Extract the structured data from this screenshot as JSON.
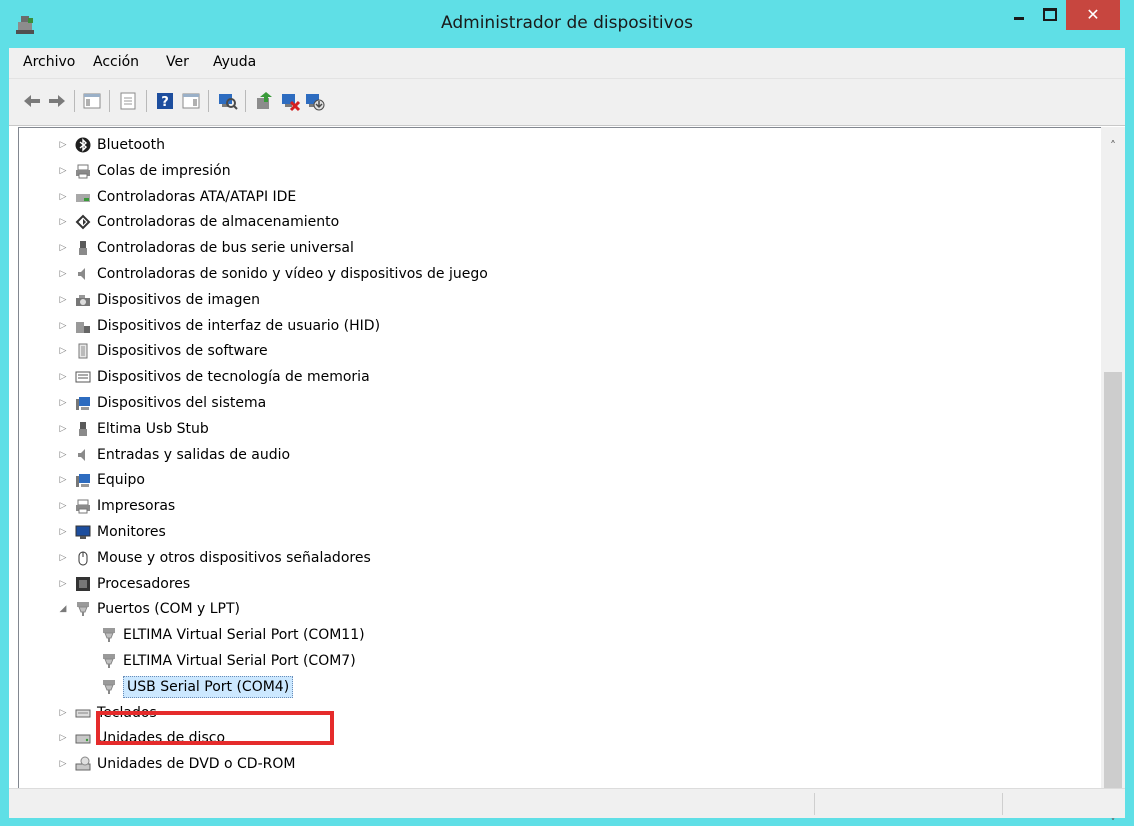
{
  "window": {
    "title": "Administrador de dispositivos",
    "close_glyph": "✕"
  },
  "menubar": {
    "items": [
      "Archivo",
      "Acción",
      "Ver",
      "Ayuda"
    ]
  },
  "toolbar": {
    "icons": [
      "back-arrow-icon",
      "forward-arrow-icon",
      "show-hide-console-tree-icon",
      "properties-icon",
      "help-icon",
      "show-action-pane-icon",
      "scan-hardware-changes-icon",
      "update-driver-icon",
      "uninstall-device-icon",
      "disable-device-icon"
    ]
  },
  "tree": {
    "items": [
      {
        "label": "Bluetooth",
        "icon": "bluetooth-icon",
        "expander": "▷",
        "level": 0
      },
      {
        "label": "Colas de impresión",
        "icon": "print-queue-icon",
        "expander": "▷",
        "level": 0
      },
      {
        "label": "Controladoras ATA/ATAPI IDE",
        "icon": "ide-controller-icon",
        "expander": "▷",
        "level": 0
      },
      {
        "label": "Controladoras de almacenamiento",
        "icon": "storage-controller-icon",
        "expander": "▷",
        "level": 0
      },
      {
        "label": "Controladoras de bus serie universal",
        "icon": "usb-controller-icon",
        "expander": "▷",
        "level": 0
      },
      {
        "label": "Controladoras de sonido y vídeo y dispositivos de juego",
        "icon": "sound-icon",
        "expander": "▷",
        "level": 0
      },
      {
        "label": "Dispositivos de imagen",
        "icon": "imaging-device-icon",
        "expander": "▷",
        "level": 0
      },
      {
        "label": "Dispositivos de interfaz de usuario (HID)",
        "icon": "hid-icon",
        "expander": "▷",
        "level": 0
      },
      {
        "label": "Dispositivos de software",
        "icon": "software-device-icon",
        "expander": "▷",
        "level": 0
      },
      {
        "label": "Dispositivos de tecnología de memoria",
        "icon": "memory-device-icon",
        "expander": "▷",
        "level": 0
      },
      {
        "label": "Dispositivos del sistema",
        "icon": "system-device-icon",
        "expander": "▷",
        "level": 0
      },
      {
        "label": "Eltima Usb Stub",
        "icon": "usb-stub-icon",
        "expander": "▷",
        "level": 0
      },
      {
        "label": "Entradas y salidas de audio",
        "icon": "audio-io-icon",
        "expander": "▷",
        "level": 0
      },
      {
        "label": "Equipo",
        "icon": "computer-icon",
        "expander": "▷",
        "level": 0
      },
      {
        "label": "Impresoras",
        "icon": "printer-icon",
        "expander": "▷",
        "level": 0
      },
      {
        "label": "Monitores",
        "icon": "monitor-icon",
        "expander": "▷",
        "level": 0
      },
      {
        "label": "Mouse y otros dispositivos señaladores",
        "icon": "mouse-icon",
        "expander": "▷",
        "level": 0
      },
      {
        "label": "Procesadores",
        "icon": "processor-icon",
        "expander": "▷",
        "level": 0
      },
      {
        "label": "Puertos (COM y LPT)",
        "icon": "port-icon",
        "expander": "◢",
        "level": 0
      },
      {
        "label": "ELTIMA Virtual Serial Port (COM11)",
        "icon": "port-icon",
        "expander": "",
        "level": 1
      },
      {
        "label": "ELTIMA Virtual Serial Port (COM7)",
        "icon": "port-icon",
        "expander": "",
        "level": 1
      },
      {
        "label": "USB Serial Port (COM4)",
        "icon": "port-icon",
        "expander": "",
        "level": 1,
        "selected": true
      },
      {
        "label": "Teclados",
        "icon": "keyboard-icon",
        "expander": "▷",
        "level": 0
      },
      {
        "label": "Unidades de disco",
        "icon": "disk-drive-icon",
        "expander": "▷",
        "level": 0
      },
      {
        "label": "Unidades de DVD o CD-ROM",
        "icon": "dvd-drive-icon",
        "expander": "▷",
        "level": 0
      }
    ]
  },
  "scrollbar": {
    "up_glyph": "˄",
    "down_glyph": "˅"
  },
  "colors": {
    "titlebar": "#5fdfe6",
    "close_button": "#c7463f",
    "highlight_box": "#e52b2b",
    "selection": "#cce8ff"
  }
}
